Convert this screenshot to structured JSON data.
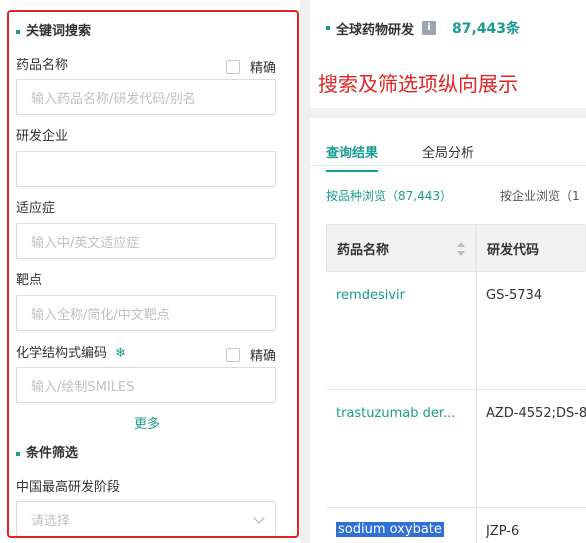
{
  "left": {
    "keyword_section": "关键词搜索",
    "fields": {
      "drug_name": {
        "label": "药品名称",
        "placeholder": "输入药品名称/研发代码/别名",
        "exact": "精确"
      },
      "company": {
        "label": "研发企业",
        "placeholder": ""
      },
      "indication": {
        "label": "适应症",
        "placeholder": "输入中/英文适应症"
      },
      "target": {
        "label": "靶点",
        "placeholder": "输入全称/简化/中文靶点"
      },
      "structure": {
        "label": "化学结构式编码",
        "icon": "snowflake-icon",
        "placeholder": "输入/绘制SMILES",
        "exact": "精确"
      }
    },
    "more": "更多",
    "filter_section": "条件筛选",
    "stage": {
      "label": "中国最高研发阶段",
      "placeholder": "请选择"
    }
  },
  "right": {
    "header_title": "全球药物研发",
    "info_icon": "i",
    "count": "87,443条",
    "annotation": "搜索及筛选项纵向展示",
    "tabs": [
      "查询结果",
      "全局分析"
    ],
    "browse_by_drug": "按品种浏览（87,443）",
    "browse_by_company": "按企业浏览（1",
    "table": {
      "headers": [
        "药品名称",
        "研发代码"
      ],
      "rows": [
        {
          "name": "remdesivir",
          "code": "GS-5734"
        },
        {
          "name": "trastuzumab der...",
          "code": "AZD-4552;DS-8"
        },
        {
          "name": "sodium oxybate",
          "code": "JZP-6"
        }
      ]
    }
  },
  "colors": {
    "accent": "#1a9b8f",
    "annotation_red": "#e02424",
    "selection": "#2f6fd6"
  }
}
